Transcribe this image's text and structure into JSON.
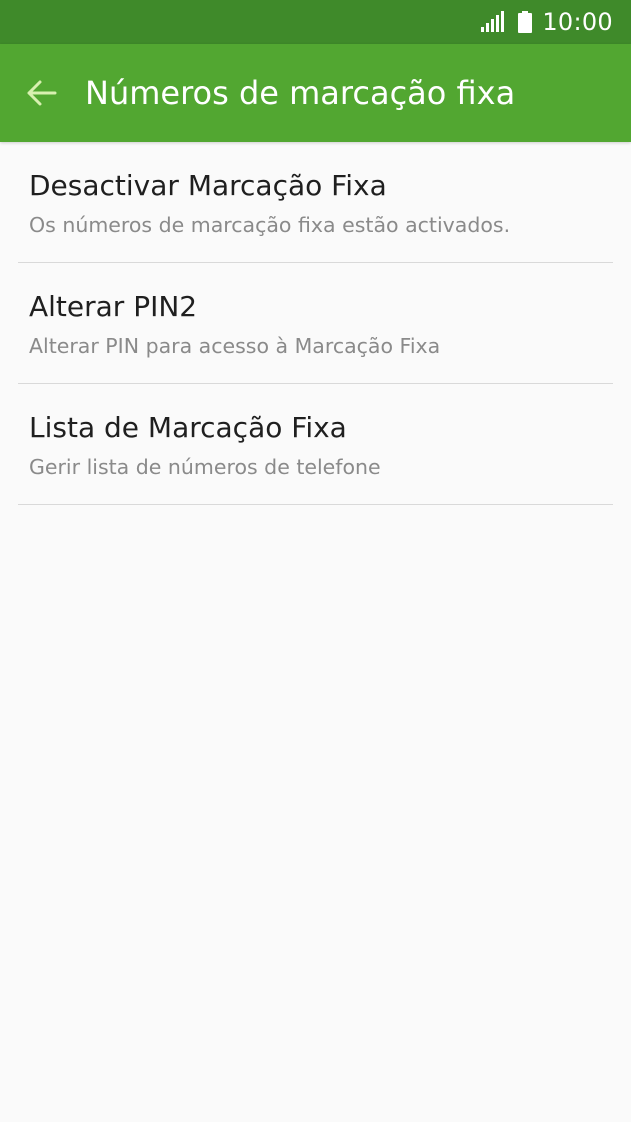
{
  "status_bar": {
    "time": "10:00",
    "icons": [
      "signal-icon",
      "battery-icon"
    ]
  },
  "app_bar": {
    "back_icon": "arrow-left-icon",
    "title": "Números de marcação fixa"
  },
  "list": {
    "items": [
      {
        "title": "Desactivar Marcação Fixa",
        "subtitle": "Os números de marcação fixa estão activados."
      },
      {
        "title": "Alterar PIN2",
        "subtitle": "Alterar PIN para acesso à Marcação Fixa"
      },
      {
        "title": "Lista de Marcação Fixa",
        "subtitle": "Gerir lista de números de telefone"
      }
    ]
  },
  "colors": {
    "status_bar": "#3f8a2a",
    "app_bar": "#52a731",
    "back_arrow": "#d8f0b0",
    "background": "#fafafa",
    "divider": "#d9d9d9"
  }
}
